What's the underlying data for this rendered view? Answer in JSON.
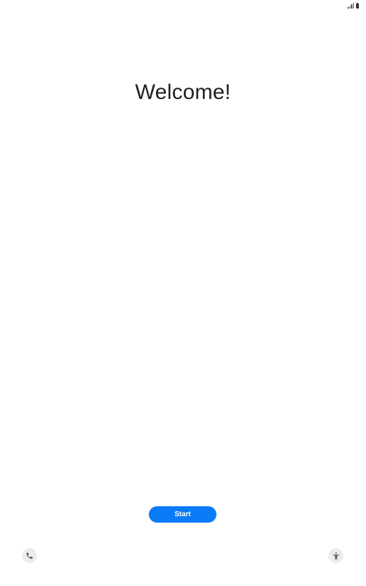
{
  "status_bar": {
    "icons": [
      "signal-icon",
      "battery-icon"
    ]
  },
  "welcome": {
    "title": "Welcome!"
  },
  "actions": {
    "start_label": "Start",
    "start_color": "#0a7cf8"
  },
  "bottom_bar": {
    "left_icon": "phone-icon",
    "right_icon": "accessibility-icon"
  }
}
